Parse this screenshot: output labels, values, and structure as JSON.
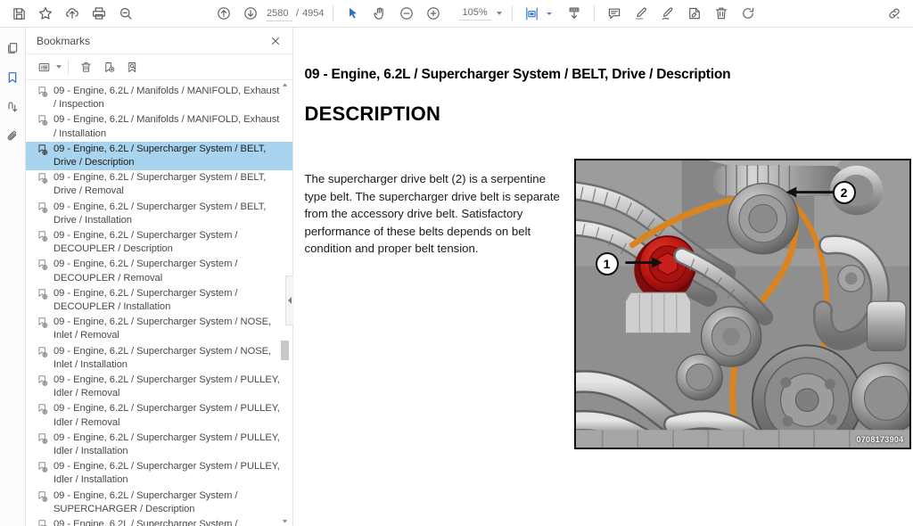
{
  "toolbar": {
    "save_label": "Save",
    "bookmark_label": "Add bookmark",
    "upload_label": "Upload",
    "print_label": "Print",
    "search_label": "Search",
    "prev_page_label": "Previous page",
    "next_page_label": "Next page",
    "page_current": "2580",
    "page_separator": "/",
    "page_total": "4954",
    "select_tool_label": "Select",
    "pan_tool_label": "Pan",
    "zoom_out_label": "Zoom out",
    "zoom_in_label": "Zoom in",
    "zoom_value": "105%",
    "fit_label": "Fit page",
    "download_label": "Download",
    "comment_label": "Comment",
    "highlight_label": "Highlight",
    "draw_label": "Draw",
    "stamp_label": "Stamp",
    "delete_label": "Delete",
    "rotate_label": "Rotate",
    "link_label": "Link"
  },
  "rail": {
    "items": [
      {
        "name": "pages-icon",
        "label": "Page thumbnails",
        "selected": false
      },
      {
        "name": "bookmark-icon",
        "label": "Bookmarks",
        "selected": true
      },
      {
        "name": "signature-icon",
        "label": "Signatures",
        "selected": false
      },
      {
        "name": "attachment-icon",
        "label": "Attachments",
        "selected": false
      }
    ]
  },
  "panel": {
    "title": "Bookmarks",
    "close_label": "Close",
    "tools": {
      "options_label": "Bookmark options",
      "delete_label": "Delete bookmark",
      "add_label": "Add bookmark",
      "find_label": "Find bookmark"
    },
    "bookmarks": [
      {
        "text": "09 - Engine, 6.2L / Manifolds / MANIFOLD, Exhaust / Inspection",
        "selected": false
      },
      {
        "text": "09 - Engine, 6.2L / Manifolds / MANIFOLD, Exhaust / Installation",
        "selected": false
      },
      {
        "text": "09 - Engine, 6.2L / Supercharger System / BELT, Drive / Description",
        "selected": true
      },
      {
        "text": "09 - Engine, 6.2L / Supercharger System / BELT, Drive / Removal",
        "selected": false
      },
      {
        "text": "09 - Engine, 6.2L / Supercharger System / BELT, Drive / Installation",
        "selected": false
      },
      {
        "text": "09 - Engine, 6.2L / Supercharger System / DECOUPLER / Description",
        "selected": false
      },
      {
        "text": "09 - Engine, 6.2L / Supercharger System / DECOUPLER / Removal",
        "selected": false
      },
      {
        "text": "09 - Engine, 6.2L / Supercharger System / DECOUPLER / Installation",
        "selected": false
      },
      {
        "text": "09 - Engine, 6.2L / Supercharger System / NOSE, Inlet / Removal",
        "selected": false
      },
      {
        "text": "09 - Engine, 6.2L / Supercharger System / NOSE, Inlet / Installation",
        "selected": false
      },
      {
        "text": "09 - Engine, 6.2L / Supercharger System / PULLEY, Idler / Removal",
        "selected": false
      },
      {
        "text": "09 - Engine, 6.2L / Supercharger System / PULLEY, Idler / Removal",
        "selected": false
      },
      {
        "text": "09 - Engine, 6.2L / Supercharger System / PULLEY, Idler / Installation",
        "selected": false
      },
      {
        "text": "09 - Engine, 6.2L / Supercharger System / PULLEY, Idler / Installation",
        "selected": false
      },
      {
        "text": "09 - Engine, 6.2L / Supercharger System / SUPERCHARGER / Description",
        "selected": false
      },
      {
        "text": "09 - Engine, 6.2L / Supercharger System /",
        "selected": false
      }
    ]
  },
  "document": {
    "breadcrumb": "09 - Engine, 6.2L / Supercharger System / BELT, Drive / Description",
    "heading": "DESCRIPTION",
    "paragraph": "The supercharger drive belt (2) is a serpentine type belt. The supercharger drive belt is separate from the accessory drive belt. Satisfactory performance of these belts depends on belt condition and proper belt tension.",
    "figure": {
      "code": "0708173904",
      "callouts": [
        {
          "number": "1",
          "describes": "supercharger drive belt tensioner pulley"
        },
        {
          "number": "2",
          "describes": "supercharger drive belt"
        }
      ]
    }
  },
  "colors": {
    "accent": "#2f6fc4",
    "selection": "#a8d4ef",
    "belt": "#e08a22",
    "callout_highlight": "#c01414"
  }
}
